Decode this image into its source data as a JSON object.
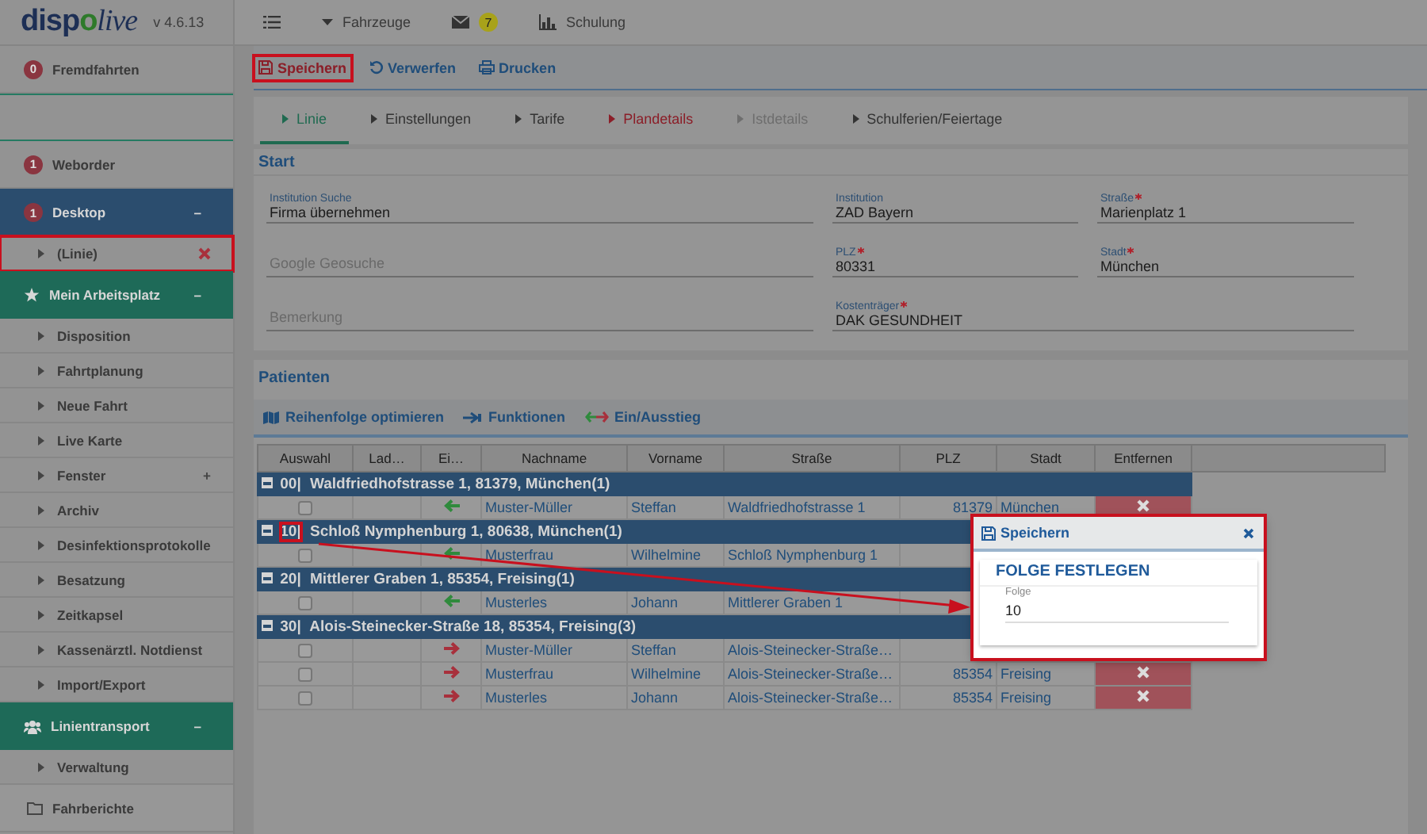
{
  "logo": {
    "parts": [
      {
        "text": "disp",
        "accent": false,
        "italic": false
      },
      {
        "text": "o",
        "accent": true,
        "italic": false
      },
      {
        "text": "live",
        "accent": false,
        "italic": true
      }
    ],
    "version": "v 4.6.13"
  },
  "sidebar": {
    "items": [
      {
        "kind": "badge-item",
        "label": "Fremdfahrten",
        "badge": "0"
      },
      {
        "kind": "spacer"
      },
      {
        "kind": "badge-item",
        "label": "Weborder",
        "badge": "1"
      },
      {
        "kind": "section",
        "label": "Desktop",
        "badge": "1",
        "color": "#2b4d6e",
        "toggle": "–",
        "expanded": true,
        "children": [
          {
            "label": "(Linie)",
            "closable": true,
            "highlighted": true
          }
        ]
      },
      {
        "kind": "section",
        "label": "Mein Arbeitsplatz",
        "color": "#1e6a58",
        "toggle": "–",
        "expanded": true,
        "children": [
          {
            "label": "Disposition",
            "closable": false,
            "highlighted": false
          },
          {
            "label": "Fahrtplanung",
            "closable": false,
            "highlighted": false
          },
          {
            "label": "Neue Fahrt",
            "closable": false,
            "highlighted": false
          },
          {
            "label": "Live Karte",
            "closable": false,
            "highlighted": false
          },
          {
            "label": "Fenster",
            "toggle": "+",
            "closable": false,
            "highlighted": false
          },
          {
            "label": "Archiv",
            "closable": false,
            "highlighted": false
          },
          {
            "label": "Desinfektionsprotokolle",
            "closable": false,
            "highlighted": false
          },
          {
            "label": "Besatzung",
            "closable": false,
            "highlighted": false
          },
          {
            "label": "Zeitkapsel",
            "closable": false,
            "highlighted": false
          },
          {
            "label": "Kassenärztl. Notdienst",
            "closable": false,
            "highlighted": false
          },
          {
            "label": "Import/Export",
            "closable": false,
            "highlighted": false
          }
        ]
      },
      {
        "kind": "section",
        "label": "Linientransport",
        "color": "#1e6a58",
        "toggle": "–",
        "expanded": true,
        "children": [
          {
            "label": "Verwaltung",
            "closable": false,
            "highlighted": false
          }
        ]
      },
      {
        "kind": "folder-item",
        "label": "Fahrberichte"
      }
    ]
  },
  "topbar": {
    "items": [
      {
        "kind": "menu"
      },
      {
        "kind": "dropdown",
        "label": "Fahrzeuge"
      },
      {
        "kind": "mail",
        "badge": "7"
      },
      {
        "kind": "chart",
        "label": "Schulung"
      }
    ]
  },
  "toolbar": [
    {
      "kind": "save",
      "label": "Speichern",
      "highlighted": true
    },
    {
      "kind": "undo",
      "label": "Verwerfen",
      "highlighted": false
    },
    {
      "kind": "print",
      "label": "Drucken",
      "highlighted": false
    }
  ],
  "tabs": [
    {
      "label": "Linie",
      "selected": true,
      "invalid": false,
      "disabled": false
    },
    {
      "label": "Einstellungen",
      "selected": false,
      "invalid": false,
      "disabled": false
    },
    {
      "label": "Tarife",
      "selected": false,
      "invalid": false,
      "disabled": false
    },
    {
      "label": "Plandetails",
      "selected": false,
      "invalid": true,
      "disabled": false
    },
    {
      "label": "Istdetails",
      "selected": false,
      "invalid": false,
      "disabled": true
    },
    {
      "label": "Schulferien/Feiertage",
      "selected": false,
      "invalid": false,
      "disabled": false
    }
  ],
  "start": {
    "title": "Start",
    "fields": [
      {
        "label": "Institution Suche",
        "value": "Firma übernehmen",
        "required": false
      },
      {
        "label": "Institution",
        "value": "ZAD Bayern",
        "required": false
      },
      {
        "label": "Straße",
        "value": "Marienplatz 1",
        "required": true
      },
      {
        "placeholder": "Google Geosuche"
      },
      {
        "label": "PLZ",
        "value": "80331",
        "required": true
      },
      {
        "label": "Stadt",
        "value": "München",
        "required": true
      },
      {
        "placeholder": "Bemerkung"
      },
      {
        "label": "Kostenträger",
        "value": "DAK GESUNDHEIT",
        "required": true
      }
    ]
  },
  "patients": {
    "title": "Patienten",
    "actions": [
      {
        "kind": "map",
        "label": "Reihenfolge optimieren"
      },
      {
        "kind": "arrow",
        "label": "Funktionen"
      },
      {
        "kind": "swap",
        "label": "Ein/Ausstieg"
      }
    ],
    "columns": [
      "Auswahl",
      "Lad…",
      "Ei…",
      "Nachname",
      "Vorname",
      "Straße",
      "PLZ",
      "Stadt",
      "Entfernen"
    ],
    "groups": [
      {
        "sequence": "00|",
        "address": "Waldfriedhofstrasse 1, 81379, München(1)",
        "expanded": true,
        "highlighted": false,
        "rows": [
          {
            "checked": false,
            "kind": "in",
            "last_name": "Muster-Müller",
            "first_name": "Steffan",
            "street": "Waldfriedhofstrasse 1",
            "zip": "81379",
            "city": "München",
            "removable": true
          }
        ]
      },
      {
        "sequence": "10|",
        "address": "Schloß Nymphenburg 1, 80638, München(1)",
        "expanded": true,
        "highlighted": true,
        "rows": [
          {
            "checked": false,
            "kind": "in",
            "last_name": "Musterfrau",
            "first_name": "Wilhelmine",
            "street": "Schloß Nymphenburg 1"
          }
        ]
      },
      {
        "sequence": "20|",
        "address": "Mittlerer Graben 1, 85354, Freising(1)",
        "expanded": true,
        "highlighted": false,
        "rows": [
          {
            "checked": false,
            "kind": "in",
            "last_name": "Musterles",
            "first_name": "Johann",
            "street": "Mittlerer Graben 1"
          }
        ]
      },
      {
        "sequence": "30|",
        "address": "Alois-Steinecker-Straße 18, 85354, Freising(3)",
        "expanded": true,
        "highlighted": false,
        "rows": [
          {
            "checked": false,
            "kind": "out",
            "last_name": "Muster-Müller",
            "first_name": "Steffan",
            "street": "Alois-Steinecker-Straße…"
          },
          {
            "checked": false,
            "kind": "out",
            "last_name": "Musterfrau",
            "first_name": "Wilhelmine",
            "street": "Alois-Steinecker-Straße…",
            "zip": "85354",
            "city": "Freising",
            "removable": true
          },
          {
            "checked": false,
            "kind": "out",
            "last_name": "Musterles",
            "first_name": "Johann",
            "street": "Alois-Steinecker-Straße…",
            "zip": "85354",
            "city": "Freising",
            "removable": true
          }
        ]
      }
    ]
  },
  "dialog": {
    "title": "Speichern",
    "heading": "FOLGE FESTLEGEN",
    "field_label": "Folge",
    "value": "10",
    "highlighted": true
  }
}
